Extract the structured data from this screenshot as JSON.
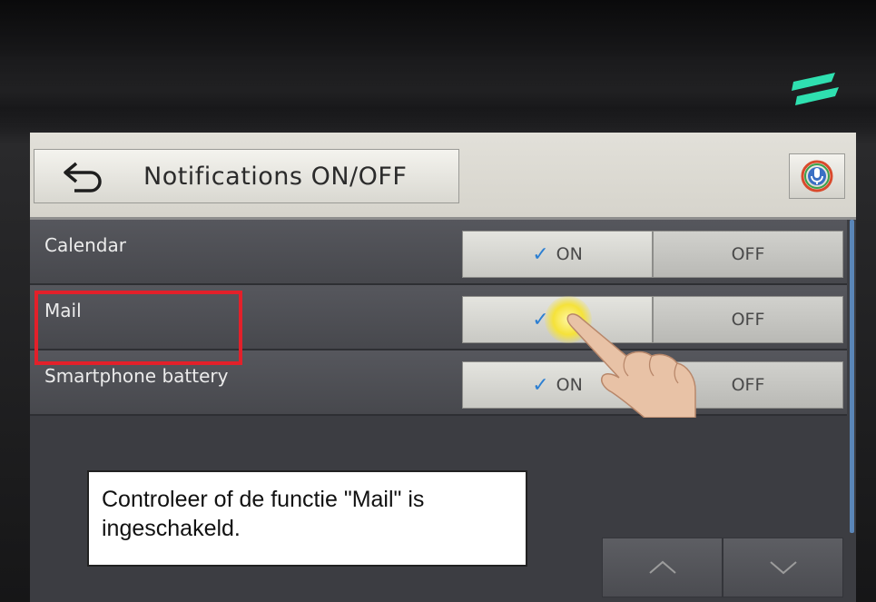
{
  "screen": {
    "title": "Notifications ON/OFF",
    "settings": [
      {
        "label": "Calendar",
        "on_label": "ON",
        "off_label": "OFF",
        "selected": "ON"
      },
      {
        "label": "Mail",
        "on_label": "ON",
        "off_label": "OFF",
        "selected": "ON"
      },
      {
        "label": "Smartphone battery",
        "on_label": "ON",
        "off_label": "OFF",
        "selected": "ON"
      }
    ],
    "page_up_icon": "^",
    "page_down_icon": "v"
  },
  "annotation": {
    "caption": "Controleer of de functie \"Mail\" is ingeschakeld.",
    "highlight_color": "#e3202a",
    "highlight_target": "Mail"
  },
  "colors": {
    "check": "#2c7fd2",
    "titlebar": "#dedcd5",
    "list_background": "#4d4e53"
  },
  "icons": [
    "back-arrow-icon",
    "microphone-icon",
    "check-icon",
    "chevron-up-icon",
    "chevron-down-icon",
    "pointing-hand-icon",
    "brand-logo-icon"
  ]
}
